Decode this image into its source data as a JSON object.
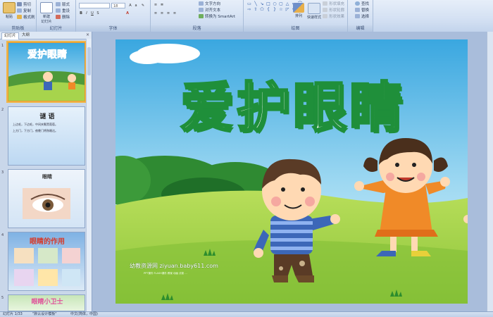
{
  "ribbon": {
    "groups": {
      "clipboard": "剪贴板",
      "slides": "幻灯片",
      "font": "字体",
      "paragraph": "段落",
      "drawing": "绘图",
      "editing": "编辑"
    },
    "paste": "粘贴",
    "cut": "剪切",
    "copy": "复制",
    "format_painter": "格式刷",
    "new_slide": "新建\n幻灯片",
    "layout": "版式",
    "reset": "重设",
    "delete": "删除",
    "font_size": "18",
    "text_direction": "文字方向",
    "align_text": "对齐文本",
    "smartart": "转换为 SmartArt",
    "arrange": "排列",
    "quick_styles": "快速样式",
    "shape_fill": "形状填充",
    "shape_outline": "形状轮廓",
    "shape_effects": "形状效果",
    "find": "查找",
    "replace": "替换",
    "select": "选择"
  },
  "left_panel": {
    "tabs": [
      "幻灯片",
      "大纲"
    ],
    "close_symbol": "×",
    "thumbnails": [
      {
        "number": "1",
        "title": "爱护眼睛"
      },
      {
        "number": "2",
        "title": "谜 语",
        "lines": [
          "上边毛，下边毛，中间夹颗黑葡萄。",
          "上方门，下方门，夜晚门将熟睡达。"
        ]
      },
      {
        "number": "3",
        "title": "眼睛"
      },
      {
        "number": "4",
        "title": "眼睛的作用"
      },
      {
        "number": "5",
        "title": "眼睛小卫士"
      }
    ]
  },
  "slide": {
    "title": "爱护眼睛",
    "watermark_main": "幼教资源网 ziyuan.baby611.com",
    "watermark_sub": "PPT课件 FLASH课件 教案 动画 试卷 …"
  },
  "colors": {
    "sky_top": "#3aa7e0",
    "sky_bottom": "#bde6f6",
    "grass": "#a7d44c",
    "title_fill": "#ffffff",
    "title_stroke": "#1f8f3a",
    "selection": "#f0b64a"
  },
  "status": {
    "slide_info": "幻灯片 1/33",
    "theme": "\"默认设计模板\"",
    "language": "中文(简体，中国)"
  }
}
